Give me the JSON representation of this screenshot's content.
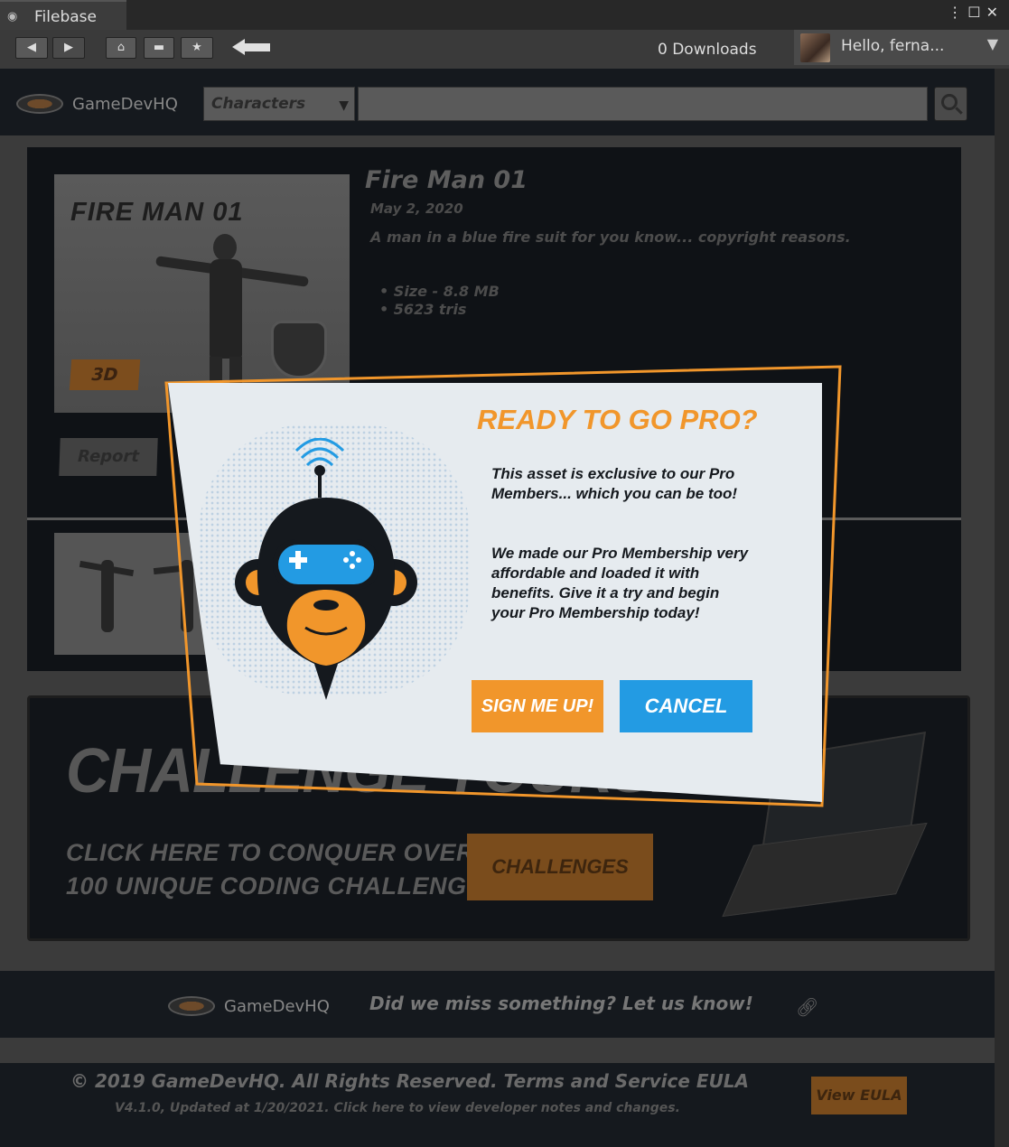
{
  "window": {
    "title": "Filebase",
    "menu_icon": "kebab-icon",
    "maximize_icon": "maximize-icon",
    "close_icon": "close-icon"
  },
  "toolbar": {
    "back_icon": "◀",
    "forward_icon": "▶",
    "home_icon": "⌂",
    "folder_icon": "▬",
    "star_icon": "★",
    "downloads": "0 Downloads",
    "greeting": "Hello, ferna..."
  },
  "search": {
    "category": "Characters",
    "query": ""
  },
  "asset": {
    "thumbnail_title": "FIRE MAN 01",
    "type_badge": "3D",
    "report_label": "Report",
    "name": "Fire Man 01",
    "date": "May 2, 2020",
    "description": "A man in a blue fire suit for you know... copyright reasons.",
    "specs": [
      "• Size - 8.8 MB",
      "• 5623 tris"
    ]
  },
  "challenge": {
    "headline": "CHALLENGE YOURSELF",
    "line1": "CLICK HERE TO CONQUER OVER",
    "line2": "100 UNIQUE CODING CHALLENGES",
    "button": "CHALLENGES"
  },
  "footer": {
    "brand": "GameDevHQ",
    "feedback": "Did we miss something? Let us know!",
    "copyright": "© 2019 GameDevHQ. All Rights Reserved. Terms and Service EULA",
    "version": "V4.1.0, Updated at 1/20/2021. Click here to view developer notes and changes.",
    "eula_button": "View EULA"
  },
  "header": {
    "brand": "GameDevHQ"
  },
  "modal": {
    "title": "READY TO GO PRO?",
    "para1": "This asset is exclusive to our Pro Members... which you can be too!",
    "para2": "We made our Pro Membership very affordable and loaded it with benefits. Give it a try and begin your Pro Membership today!",
    "signup": "SIGN ME UP!",
    "cancel": "CANCEL"
  },
  "colors": {
    "accent_orange": "#f1962b",
    "accent_blue": "#239be3",
    "dark_panel": "#15191e"
  }
}
